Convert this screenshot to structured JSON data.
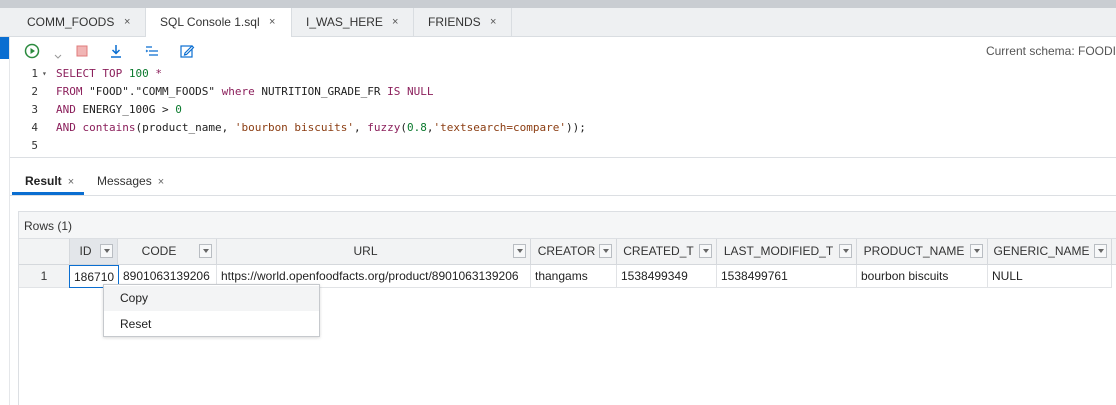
{
  "tabs": [
    {
      "label": "COMM_FOODS",
      "close": "×",
      "active": false
    },
    {
      "label": "SQL Console 1.sql",
      "close": "×",
      "active": true
    },
    {
      "label": "I_WAS_HERE",
      "close": "×",
      "active": false
    },
    {
      "label": "FRIENDS",
      "close": "×",
      "active": false
    }
  ],
  "toolbar": {
    "run_icon": "run-icon",
    "stop_icon": "stop-icon",
    "download_icon": "download-icon",
    "format_icon": "format-icon",
    "edit_icon": "edit-icon",
    "schema_label": "Current schema: FOODI"
  },
  "editor": {
    "line_numbers": [
      "1",
      "2",
      "3",
      "4",
      "5"
    ],
    "fold_marker": "▾",
    "lines": [
      {
        "segments": [
          {
            "t": "SELECT TOP ",
            "c": "kw"
          },
          {
            "t": "100",
            "c": "num"
          },
          {
            "t": " *",
            "c": "kw"
          }
        ]
      },
      {
        "segments": [
          {
            "t": "FROM ",
            "c": "kw"
          },
          {
            "t": "\"FOOD\".\"COMM_FOODS\"",
            "c": ""
          },
          {
            "t": " where ",
            "c": "kw"
          },
          {
            "t": "NUTRITION_GRADE_FR ",
            "c": ""
          },
          {
            "t": "IS NULL",
            "c": "kw"
          }
        ]
      },
      {
        "segments": [
          {
            "t": "AND ",
            "c": "kw"
          },
          {
            "t": "ENERGY_100G > ",
            "c": ""
          },
          {
            "t": "0",
            "c": "num"
          }
        ]
      },
      {
        "segments": [
          {
            "t": "AND ",
            "c": "kw"
          },
          {
            "t": "contains",
            "c": "fn"
          },
          {
            "t": "(product_name, ",
            "c": ""
          },
          {
            "t": "'bourbon biscuits'",
            "c": "str"
          },
          {
            "t": ", ",
            "c": ""
          },
          {
            "t": "fuzzy",
            "c": "fn"
          },
          {
            "t": "(",
            "c": ""
          },
          {
            "t": "0.8",
            "c": "num"
          },
          {
            "t": ",",
            "c": ""
          },
          {
            "t": "'textsearch=compare'",
            "c": "str"
          },
          {
            "t": "));",
            "c": ""
          }
        ]
      },
      {
        "segments": []
      }
    ]
  },
  "result_tabs": [
    {
      "label": "Result",
      "close": "×",
      "active": true
    },
    {
      "label": "Messages",
      "close": "×",
      "active": false
    }
  ],
  "grid": {
    "rows_label": "Rows (1)",
    "columns": [
      "ID",
      "CODE",
      "URL",
      "CREATOR",
      "CREATED_T",
      "LAST_MODIFIED_T",
      "PRODUCT_NAME",
      "GENERIC_NAME"
    ],
    "rows": [
      {
        "num": "1",
        "cells": [
          "186710",
          "8901063139206",
          "https://world.openfoodfacts.org/product/8901063139206",
          "thangams",
          "1538499349",
          "1538499761",
          "bourbon biscuits",
          "NULL"
        ]
      }
    ]
  },
  "context_menu": {
    "items": [
      {
        "label": "Copy",
        "hover": true
      },
      {
        "label": "Reset",
        "hover": false
      }
    ]
  },
  "colors": {
    "accent": "#0a6ed1",
    "keyword": "#8b1f5b",
    "string": "#8b3d12",
    "number": "#0b7a2e"
  }
}
